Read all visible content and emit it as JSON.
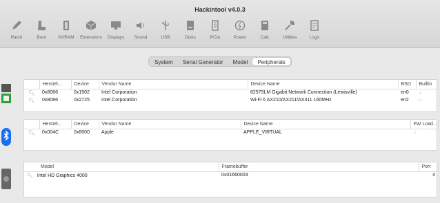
{
  "window": {
    "title": "Hackintool v4.0.3"
  },
  "toolbar": [
    {
      "label": "Patch",
      "icon": "pencil-icon"
    },
    {
      "label": "Boot",
      "icon": "boot-icon"
    },
    {
      "label": "NVRAM",
      "icon": "nvram-icon"
    },
    {
      "label": "Extensions",
      "icon": "extensions-cube-icon"
    },
    {
      "label": "Displays",
      "icon": "display-icon"
    },
    {
      "label": "Sound",
      "icon": "speaker-icon"
    },
    {
      "label": "USB",
      "icon": "usb-icon"
    },
    {
      "label": "Disks",
      "icon": "disk-icon"
    },
    {
      "label": "PCIe",
      "icon": "pcie-icon"
    },
    {
      "label": "Power",
      "icon": "power-icon"
    },
    {
      "label": "Calc",
      "icon": "calculator-icon"
    },
    {
      "label": "Utilities",
      "icon": "wrench-icon"
    },
    {
      "label": "Logs",
      "icon": "logs-icon"
    }
  ],
  "tabs": [
    "System",
    "Serial Generator",
    "Model",
    "Peripherals"
  ],
  "active_tab": "Peripherals",
  "network": {
    "headers": [
      "Herstel...",
      "Device",
      "Vendor Name",
      "Device Name",
      "BSD",
      "Builtin"
    ],
    "rows": [
      [
        "0x8086",
        "0x1502",
        "Intel Corporation",
        "82579LM Gigabit Network Connection (Lewisville)",
        "en0",
        "✓"
      ],
      [
        "0x8086",
        "0x2725",
        "Intel Corporation",
        "Wi-Fi 6 AX210/AX211/AX411 160MHz",
        "en2",
        "✓"
      ]
    ]
  },
  "bluetooth": {
    "headers": [
      "Herstel...",
      "Device",
      "Vendor Name",
      "Device Name",
      "FW Load..."
    ],
    "rows": [
      [
        "0x004C",
        "0x8000",
        "Apple",
        "APPLE_VIRTUAL",
        "✓"
      ]
    ]
  },
  "graphics": {
    "headers": [
      "Model",
      "Framebuffer",
      "Port"
    ],
    "rows": [
      [
        "Intel HD Graphics 4000",
        "0x01660003",
        "4"
      ]
    ]
  },
  "colors": {
    "network_icon": "#2e9e3e",
    "bluetooth_icon": "#1a6ff0"
  }
}
